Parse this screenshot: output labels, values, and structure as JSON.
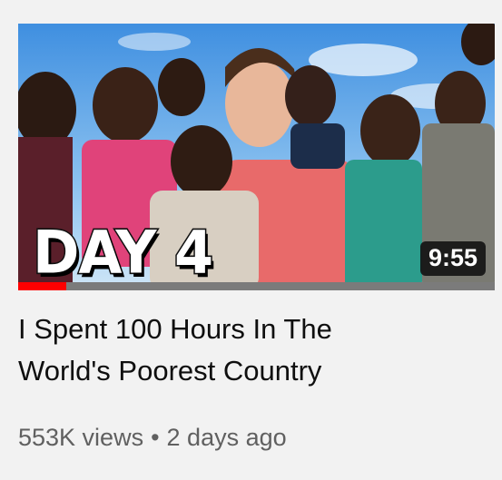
{
  "video": {
    "thumbnail_overlay": "DAY 4",
    "duration": "9:55",
    "watch_progress": 0.1,
    "title_line1": "I Spent 100 Hours In The",
    "title_line2": "World's Poorest Country",
    "views": "553K views",
    "separator": "•",
    "uploaded": "2 days ago"
  },
  "colors": {
    "background": "#f2f2f2",
    "progress": "#ff0000",
    "title_text": "#0f0f0f",
    "meta_text": "#606060"
  }
}
